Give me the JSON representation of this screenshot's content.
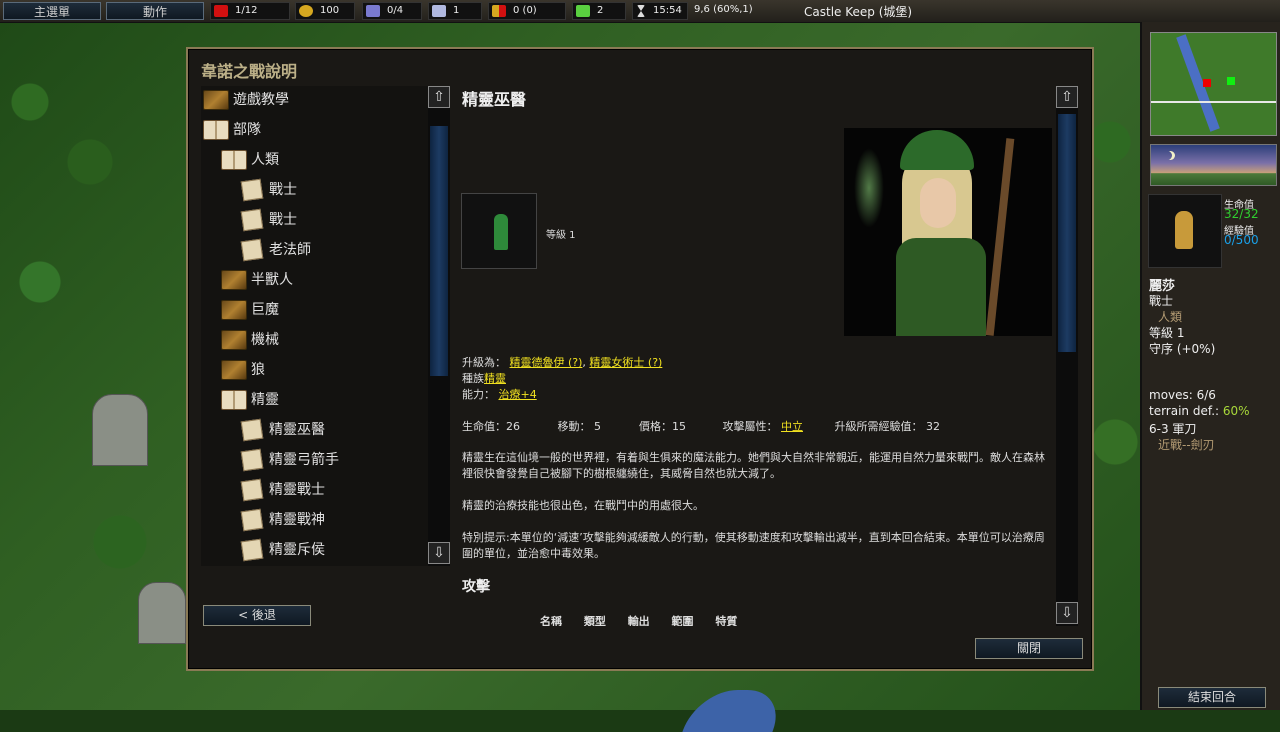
{
  "topbar": {
    "menu_label": "主選單",
    "actions_label": "動作",
    "villages": "1/12",
    "gold": "100",
    "units": "0/4",
    "upkeep": "1",
    "income": "0 (0)",
    "heal": "2",
    "time": "15:54",
    "coords": "9,6 (60%,1)",
    "map_name": "Castle Keep (城堡)"
  },
  "dialog": {
    "title": "韋諾之戰說明",
    "back_label": "< 後退",
    "close_label": "關閉",
    "tree": [
      {
        "label": "遊戲教學",
        "icon": "closed-book-icon",
        "indent": 0
      },
      {
        "label": "部隊",
        "icon": "open-book-icon",
        "indent": 0
      },
      {
        "label": "人類",
        "icon": "open-book-icon",
        "indent": 1
      },
      {
        "label": "戰士",
        "icon": "page-icon",
        "indent": 2
      },
      {
        "label": "戰士",
        "icon": "page-icon",
        "indent": 2
      },
      {
        "label": "老法師",
        "icon": "page-icon",
        "indent": 2
      },
      {
        "label": "半獸人",
        "icon": "closed-book-icon",
        "indent": 1
      },
      {
        "label": "巨魔",
        "icon": "closed-book-icon",
        "indent": 1
      },
      {
        "label": "機械",
        "icon": "closed-book-icon",
        "indent": 1
      },
      {
        "label": "狼",
        "icon": "closed-book-icon",
        "indent": 1
      },
      {
        "label": "精靈",
        "icon": "open-book-icon",
        "indent": 1
      },
      {
        "label": "精靈巫醫",
        "icon": "page-icon",
        "indent": 2
      },
      {
        "label": "精靈弓箭手",
        "icon": "page-icon",
        "indent": 2
      },
      {
        "label": "精靈戰士",
        "icon": "page-icon",
        "indent": 2
      },
      {
        "label": "精靈戰神",
        "icon": "page-icon",
        "indent": 2
      },
      {
        "label": "精靈斥侯",
        "icon": "page-icon",
        "indent": 2
      }
    ],
    "unit": {
      "title": "精靈巫醫",
      "level": "等級 1",
      "advances_label": "升級為：",
      "advance1": "精靈德魯伊 (?)",
      "advance2": "精靈女術士 (?)",
      "race_label": "種族",
      "race": "精靈",
      "ability_label": "能力：",
      "ability": "治療+4",
      "hp": "生命值：26",
      "moves": "移動： 5",
      "cost": "價格：15",
      "alignment_label": "攻擊屬性：",
      "alignment": "中立",
      "xp": "升級所需經驗值： 32",
      "desc1": "精靈生在這仙境一般的世界裡，有着與生俱來的魔法能力。她們與大自然非常親近，能運用自然力量來戰鬥。敵人在森林裡很快會發覺自己被腳下的樹根纏繞住，其威脅自然也就大減了。",
      "desc2": "精靈的治療技能也很出色，在戰鬥中的用處很大。",
      "desc3": "特別提示:本單位的‘減速’攻擊能夠減緩敵人的行動，使其移動速度和攻擊輸出減半，直到本回合結束。本單位可以治療周圍的單位，並治愈中毒效果。",
      "attacks_title": "攻擊",
      "attack_columns": [
        "名稱",
        "類型",
        "輸出",
        "範圍",
        "特質"
      ]
    }
  },
  "sidebar": {
    "hp_label": "生命值",
    "hp_value": "32/32",
    "xp_label": "經驗值",
    "xp_value": "0/500",
    "unit_name": "麗莎",
    "unit_type": "戰士",
    "unit_race": "人類",
    "unit_level": "等級 1",
    "unit_trait": "守序 (+0%)",
    "moves": "moves: 6/6",
    "terrain_label": "terrain def.:",
    "terrain_value": "60%",
    "weapon": "6-3 軍刀",
    "weapon_range": "近戰--劍刃",
    "end_turn_label": "結束回合"
  },
  "colors": {
    "accent_gold": "#bcb088",
    "link_yellow": "#f0e020",
    "hp_green": "#2fcf2f",
    "xp_blue": "#1aa0e8"
  }
}
